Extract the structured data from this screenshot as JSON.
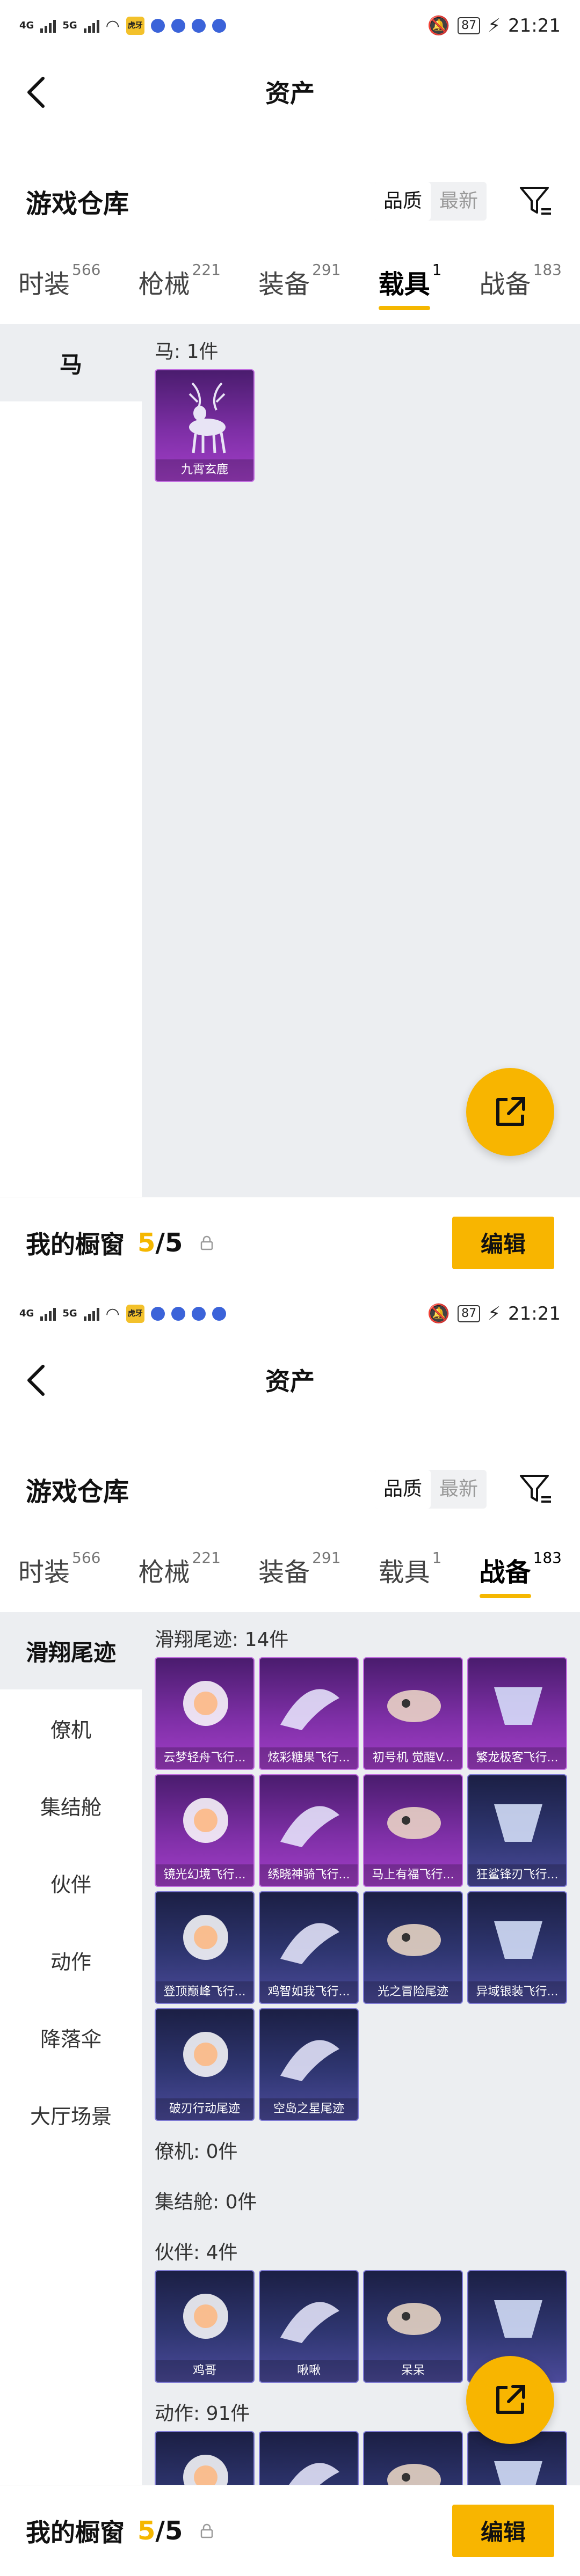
{
  "screens": [
    {
      "status": {
        "net": "4G",
        "net2": "5G",
        "app_badge": "虎牙",
        "battery": "87",
        "time": "21:21"
      },
      "header": {
        "title": "资产"
      },
      "warehouse": {
        "title": "游戏仓库",
        "sort_quality": "品质",
        "sort_latest": "最新"
      },
      "tabs": [
        {
          "label": "时装",
          "count": "566"
        },
        {
          "label": "枪械",
          "count": "221"
        },
        {
          "label": "装备",
          "count": "291"
        },
        {
          "label": "载具",
          "count": "1"
        },
        {
          "label": "战备",
          "count": "183"
        }
      ],
      "active_tab": 3,
      "sidebar": [
        {
          "label": "马"
        }
      ],
      "sections": [
        {
          "title": "马: 1件",
          "items": [
            {
              "name": "九霄玄鹿",
              "tier": "purple",
              "icon": "deer-icon"
            }
          ]
        }
      ],
      "bottom": {
        "label": "我的橱窗",
        "current": "5",
        "sep": "/",
        "total": "5",
        "edit": "编辑"
      }
    },
    {
      "status": {
        "net": "4G",
        "net2": "5G",
        "app_badge": "虎牙",
        "battery": "87",
        "time": "21:21"
      },
      "header": {
        "title": "资产"
      },
      "warehouse": {
        "title": "游戏仓库",
        "sort_quality": "品质",
        "sort_latest": "最新"
      },
      "tabs": [
        {
          "label": "时装",
          "count": "566"
        },
        {
          "label": "枪械",
          "count": "221"
        },
        {
          "label": "装备",
          "count": "291"
        },
        {
          "label": "载具",
          "count": "1"
        },
        {
          "label": "战备",
          "count": "183"
        }
      ],
      "active_tab": 4,
      "sidebar": [
        {
          "label": "滑翔尾迹"
        },
        {
          "label": "僚机"
        },
        {
          "label": "集结舱"
        },
        {
          "label": "伙伴"
        },
        {
          "label": "动作"
        },
        {
          "label": "降落伞"
        },
        {
          "label": "大厅场景"
        }
      ],
      "sections": [
        {
          "title": "滑翔尾迹: 14件",
          "items": [
            {
              "name": "云梦轻舟飞行...",
              "tier": "purple",
              "icon": "lamp-icon"
            },
            {
              "name": "炫彩糖果飞行...",
              "tier": "purple",
              "icon": "candy-icon"
            },
            {
              "name": "初号机 觉醒V...",
              "tier": "purple",
              "icon": "jet-icon"
            },
            {
              "name": "繁龙极客飞行...",
              "tier": "purple",
              "icon": "bat-icon"
            },
            {
              "name": "镜光幻境飞行...",
              "tier": "purple",
              "icon": "feather-icon"
            },
            {
              "name": "绣晓神骑飞行...",
              "tier": "purple",
              "icon": "skull-icon"
            },
            {
              "name": "马上有福飞行...",
              "tier": "purple",
              "icon": "horse-icon"
            },
            {
              "name": "狂鲨锋刃飞行...",
              "tier": "blue",
              "icon": "shark-icon"
            },
            {
              "name": "登顶巅峰飞行...",
              "tier": "blue",
              "icon": "wing-icon"
            },
            {
              "name": "鸡智如我飞行...",
              "tier": "blue",
              "icon": "chicken-icon"
            },
            {
              "name": "光之冒险尾迹",
              "tier": "blue",
              "icon": "trail-icon"
            },
            {
              "name": "异域银装飞行...",
              "tier": "blue",
              "icon": "glider-icon"
            },
            {
              "name": "破刃行动尾迹",
              "tier": "blue",
              "icon": "rainbow-trail-icon"
            },
            {
              "name": "空岛之星尾迹",
              "tier": "blue",
              "icon": "star-trail-icon"
            }
          ]
        },
        {
          "title": "僚机: 0件",
          "items": []
        },
        {
          "title": "集结舱: 0件",
          "items": []
        },
        {
          "title": "伙伴: 4件",
          "items": [
            {
              "name": "鸡哥",
              "tier": "blue",
              "icon": "rooster-icon"
            },
            {
              "name": "啾啾",
              "tier": "blue",
              "icon": "pig-icon"
            },
            {
              "name": "呆呆",
              "tier": "blue",
              "icon": "chick-icon"
            },
            {
              "name": "",
              "tier": "blue",
              "icon": "knight-icon"
            }
          ]
        },
        {
          "title": "动作: 91件",
          "items": [
            {
              "name": "",
              "tier": "blue",
              "icon": "action-icon"
            },
            {
              "name": "",
              "tier": "blue",
              "icon": "action-icon"
            },
            {
              "name": "",
              "tier": "blue",
              "icon": "action-icon"
            },
            {
              "name": "",
              "tier": "blue",
              "icon": "action-icon"
            }
          ]
        }
      ],
      "bottom": {
        "label": "我的橱窗",
        "current": "5",
        "sep": "/",
        "total": "5",
        "edit": "编辑"
      }
    }
  ],
  "colors": {
    "accent": "#f8b500",
    "purple_card": "#7e2fa6",
    "blue_card": "#2f3671",
    "panel_bg": "#eceef1"
  }
}
